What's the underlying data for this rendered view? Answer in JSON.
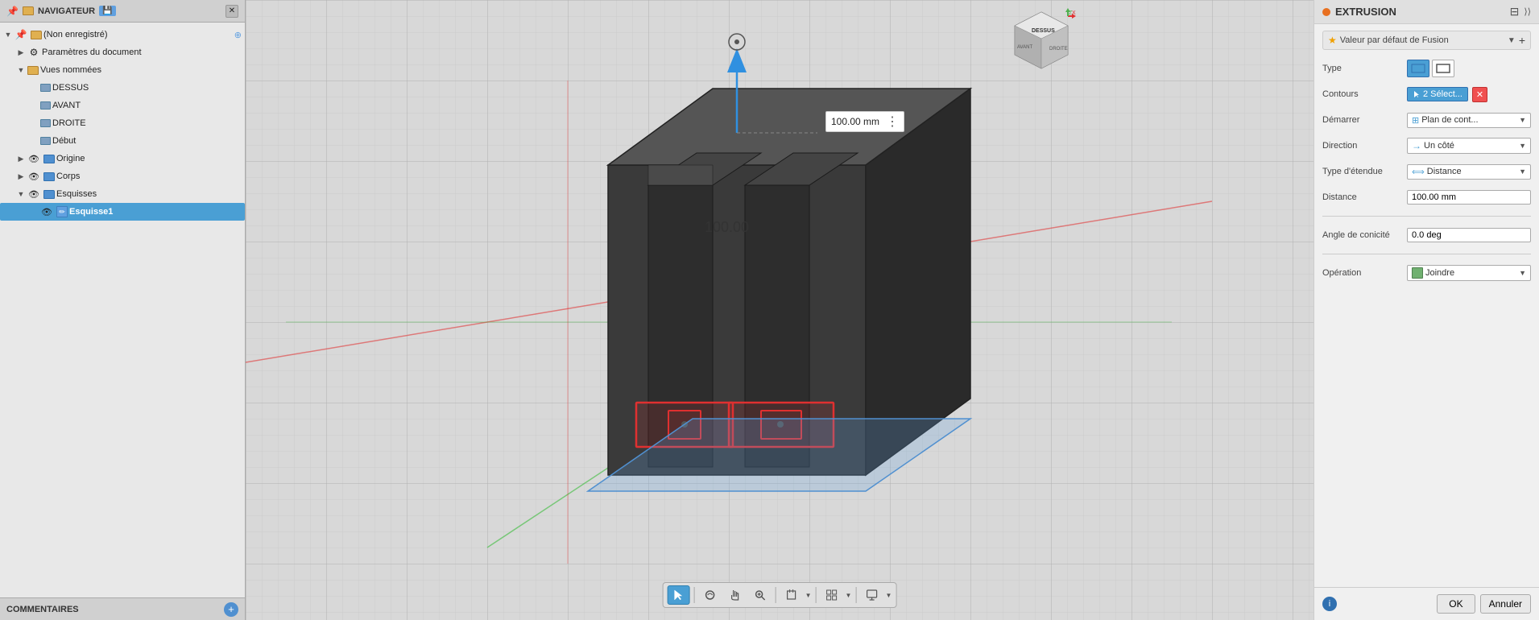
{
  "navigator": {
    "title": "NAVIGATEUR",
    "items": [
      {
        "id": "root",
        "label": "(Non enregistré)",
        "level": 0,
        "expanded": true,
        "icon": "pin-doc",
        "has_eye": false,
        "has_gear": false
      },
      {
        "id": "params",
        "label": "Paramètres du document",
        "level": 1,
        "expanded": false,
        "icon": "gear",
        "has_eye": false,
        "has_gear": true
      },
      {
        "id": "vues",
        "label": "Vues nommées",
        "level": 1,
        "expanded": true,
        "icon": "folder",
        "has_eye": false,
        "has_gear": false
      },
      {
        "id": "dessus",
        "label": "DESSUS",
        "level": 2,
        "expanded": false,
        "icon": "view",
        "has_eye": false,
        "has_gear": false
      },
      {
        "id": "avant",
        "label": "AVANT",
        "level": 2,
        "expanded": false,
        "icon": "view",
        "has_eye": false,
        "has_gear": false
      },
      {
        "id": "droite",
        "label": "DROITE",
        "level": 2,
        "expanded": false,
        "icon": "view",
        "has_eye": false,
        "has_gear": false
      },
      {
        "id": "debut",
        "label": "Début",
        "level": 2,
        "expanded": false,
        "icon": "view",
        "has_eye": false,
        "has_gear": false
      },
      {
        "id": "origine",
        "label": "Origine",
        "level": 1,
        "expanded": false,
        "icon": "folder-blue",
        "has_eye": true,
        "has_gear": false
      },
      {
        "id": "corps",
        "label": "Corps",
        "level": 1,
        "expanded": false,
        "icon": "folder-blue",
        "has_eye": true,
        "has_gear": false
      },
      {
        "id": "esquisses",
        "label": "Esquisses",
        "level": 1,
        "expanded": true,
        "icon": "folder-blue",
        "has_eye": true,
        "has_gear": false
      },
      {
        "id": "esquisse1",
        "label": "Esquisse1",
        "level": 2,
        "expanded": false,
        "icon": "sketch",
        "has_eye": true,
        "has_gear": false,
        "selected": true
      }
    ]
  },
  "comments": {
    "label": "COMMENTAIRES"
  },
  "viewport": {
    "dimension_label": "100.00 mm",
    "measure_text": "100.00"
  },
  "toolbar": {
    "buttons": [
      {
        "id": "cursor",
        "icon": "⊹",
        "active": true,
        "tooltip": "Sélection"
      },
      {
        "id": "orbit",
        "icon": "⊕",
        "active": false,
        "tooltip": "Orbiter"
      },
      {
        "id": "hand",
        "icon": "✋",
        "active": false,
        "tooltip": "Panoramique"
      },
      {
        "id": "zoom",
        "icon": "🔍",
        "active": false,
        "tooltip": "Zoom"
      },
      {
        "id": "fit",
        "icon": "⊞",
        "active": false,
        "tooltip": "Ajuster",
        "has_arrow": true
      },
      {
        "id": "grid",
        "icon": "⊟",
        "active": false,
        "tooltip": "Grille",
        "has_arrow": true
      },
      {
        "id": "display",
        "icon": "⊠",
        "active": false,
        "tooltip": "Affichage",
        "has_arrow": true
      }
    ]
  },
  "extrusion": {
    "panel_title": "EXTRUSION",
    "fusion_default_label": "Valeur par défaut de Fusion",
    "type_label": "Type",
    "type_buttons": [
      {
        "id": "solid",
        "active": true,
        "icon": "▬"
      },
      {
        "id": "surface",
        "active": false,
        "icon": "▭"
      }
    ],
    "contours_label": "Contours",
    "contours_btn": "2 Sélect...",
    "demarrer_label": "Démarrer",
    "demarrer_value": "Plan de cont...",
    "direction_label": "Direction",
    "direction_value": "Un côté",
    "type_etendue_label": "Type d'étendue",
    "type_etendue_value": "Distance",
    "distance_label": "Distance",
    "distance_value": "100.00 mm",
    "angle_label": "Angle de conicité",
    "angle_value": "0.0 deg",
    "operation_label": "Opération",
    "operation_value": "Joindre",
    "ok_label": "OK",
    "cancel_label": "Annuler",
    "info_symbol": "i"
  }
}
